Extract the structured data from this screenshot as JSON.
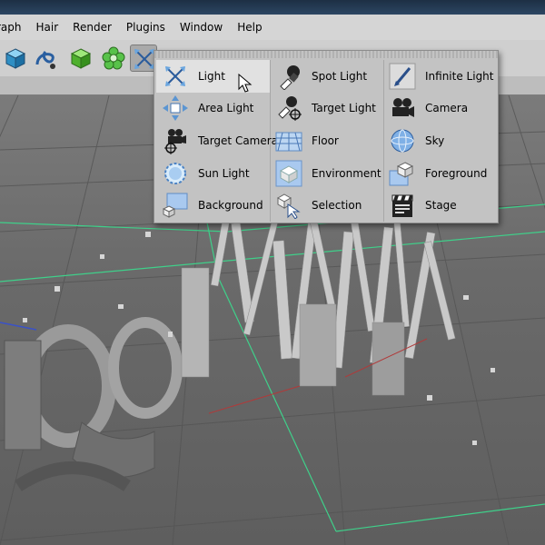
{
  "menubar": {
    "items": [
      {
        "label": "raph"
      },
      {
        "label": "Hair"
      },
      {
        "label": "Render"
      },
      {
        "label": "Plugins"
      },
      {
        "label": "Window"
      },
      {
        "label": "Help"
      }
    ]
  },
  "toolbar": {
    "tools": [
      {
        "icon": "cube-icon"
      },
      {
        "icon": "spline-icon"
      },
      {
        "icon": "generator-icon"
      },
      {
        "icon": "deformer-flower-icon"
      },
      {
        "icon": "light-arrows-icon"
      },
      {
        "icon": "render-icon"
      },
      {
        "icon": "render-settings-icon"
      },
      {
        "icon": "render-view-icon"
      }
    ]
  },
  "popup": {
    "items": [
      {
        "label": "Light",
        "icon": "light-arrows-icon",
        "state": "hover"
      },
      {
        "label": "Spot Light",
        "icon": "spot-light-icon"
      },
      {
        "label": "Infinite Light",
        "icon": "infinite-light-icon"
      },
      {
        "label": "Area Light",
        "icon": "area-light-icon"
      },
      {
        "label": "Target Light",
        "icon": "target-light-icon"
      },
      {
        "label": "Camera",
        "icon": "camera-icon"
      },
      {
        "label": "Target Camera",
        "icon": "target-camera-icon"
      },
      {
        "label": "Floor",
        "icon": "floor-icon"
      },
      {
        "label": "Sky",
        "icon": "sky-icon"
      },
      {
        "label": "Sun Light",
        "icon": "sun-light-icon"
      },
      {
        "label": "Environment",
        "icon": "environment-icon"
      },
      {
        "label": "Foreground",
        "icon": "foreground-icon"
      },
      {
        "label": "Background",
        "icon": "background-icon"
      },
      {
        "label": "Selection",
        "icon": "selection-icon"
      },
      {
        "label": "Stage",
        "icon": "stage-icon"
      }
    ]
  },
  "colors": {
    "menubar_bg": "#d5d5d5",
    "popup_bg": "#c3c3c3",
    "hover_bg": "#e1e1e1",
    "viewport_bg": "#6e6e6e",
    "grid_green": "#3fd08a"
  }
}
